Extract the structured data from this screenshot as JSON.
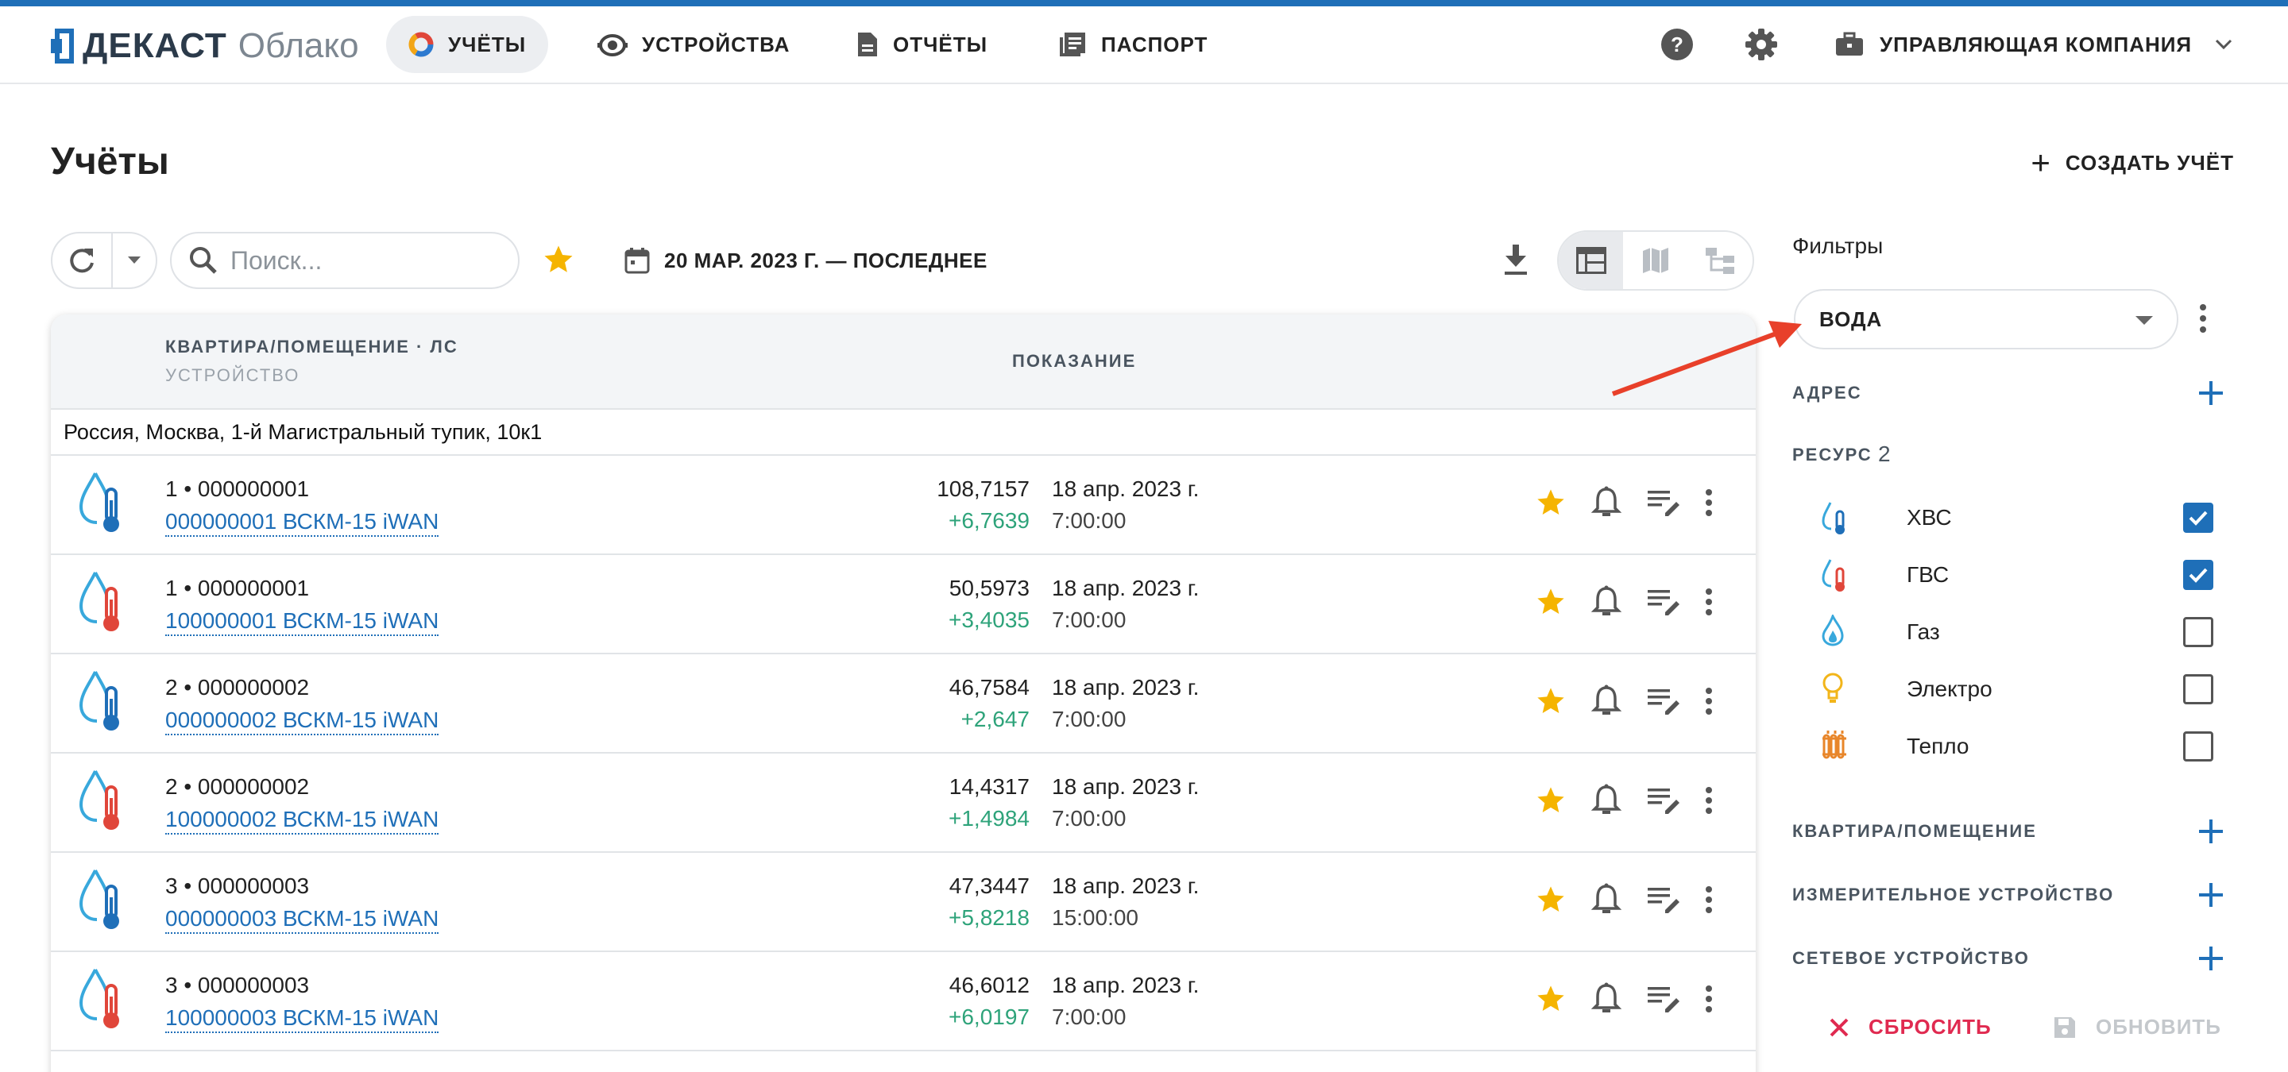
{
  "brand": {
    "name": "ДЕКАСТ",
    "product": "Облако"
  },
  "nav": {
    "accounts": "УЧЁТЫ",
    "devices": "УСТРОЙСТВА",
    "reports": "ОТЧЁТЫ",
    "passport": "ПАСПОРТ"
  },
  "account_menu": {
    "label": "УПРАВЛЯЮЩАЯ КОМПАНИЯ"
  },
  "page": {
    "title": "Учёты",
    "create_label": "СОЗДАТЬ УЧЁТ"
  },
  "toolbar": {
    "search_placeholder": "Поиск...",
    "date_range": "20 МАР. 2023 Г. — ПОСЛЕДНЕЕ"
  },
  "table": {
    "header_account": "КВАРТИРА/ПОМЕЩЕНИЕ · ЛС",
    "header_device": "УСТРОЙСТВО",
    "header_reading": "ПОКАЗАНИЕ",
    "group_address": "Россия, Москва, 1-й Магистральный тупик, 10к1",
    "rows": [
      {
        "type": "cold",
        "account": "1  •  000000001",
        "device": "000000001 ВСКМ-15 iWAN",
        "value": "108,7157",
        "delta": "+6,7639",
        "date": "18 апр. 2023 г.",
        "time": "7:00:00"
      },
      {
        "type": "hot",
        "account": "1  •  000000001",
        "device": "100000001 ВСКМ-15 iWAN",
        "value": "50,5973",
        "delta": "+3,4035",
        "date": "18 апр. 2023 г.",
        "time": "7:00:00"
      },
      {
        "type": "cold",
        "account": "2  •  000000002",
        "device": "000000002 ВСКМ-15 iWAN",
        "value": "46,7584",
        "delta": "+2,647",
        "date": "18 апр. 2023 г.",
        "time": "7:00:00"
      },
      {
        "type": "hot",
        "account": "2  •  000000002",
        "device": "100000002 ВСКМ-15 iWAN",
        "value": "14,4317",
        "delta": "+1,4984",
        "date": "18 апр. 2023 г.",
        "time": "7:00:00"
      },
      {
        "type": "cold",
        "account": "3  •  000000003",
        "device": "000000003 ВСКМ-15 iWAN",
        "value": "47,3447",
        "delta": "+5,8218",
        "date": "18 апр. 2023 г.",
        "time": "15:00:00"
      },
      {
        "type": "hot",
        "account": "3  •  000000003",
        "device": "100000003 ВСКМ-15 iWAN",
        "value": "46,6012",
        "delta": "+6,0197",
        "date": "18 апр. 2023 г.",
        "time": "7:00:00"
      }
    ]
  },
  "filters": {
    "title": "Фильтры",
    "preset": "ВОДА",
    "address_label": "АДРЕС",
    "resource_label": "РЕСУРС",
    "resource_count": "2",
    "resources": [
      {
        "name": "ХВС",
        "icon": "cold-water-icon",
        "checked": true
      },
      {
        "name": "ГВС",
        "icon": "hot-water-icon",
        "checked": true
      },
      {
        "name": "Газ",
        "icon": "gas-flame-icon",
        "checked": false
      },
      {
        "name": "Электро",
        "icon": "lightbulb-icon",
        "checked": false
      },
      {
        "name": "Тепло",
        "icon": "radiator-icon",
        "checked": false
      }
    ],
    "apartment_label": "КВАРТИРА/ПОМЕЩЕНИЕ",
    "meter_label": "ИЗМЕРИТЕЛЬНОЕ УСТРОЙСТВО",
    "network_label": "СЕТЕВОЕ УСТРОЙСТВО",
    "reset_label": "СБРОСИТЬ",
    "refresh_label": "ОБНОВИТЬ"
  },
  "colors": {
    "accent": "#1f6fb8",
    "delta_green": "#2ea37a",
    "star": "#f5b400",
    "reset_red": "#e02a50",
    "annotation_arrow": "#e8402a"
  }
}
